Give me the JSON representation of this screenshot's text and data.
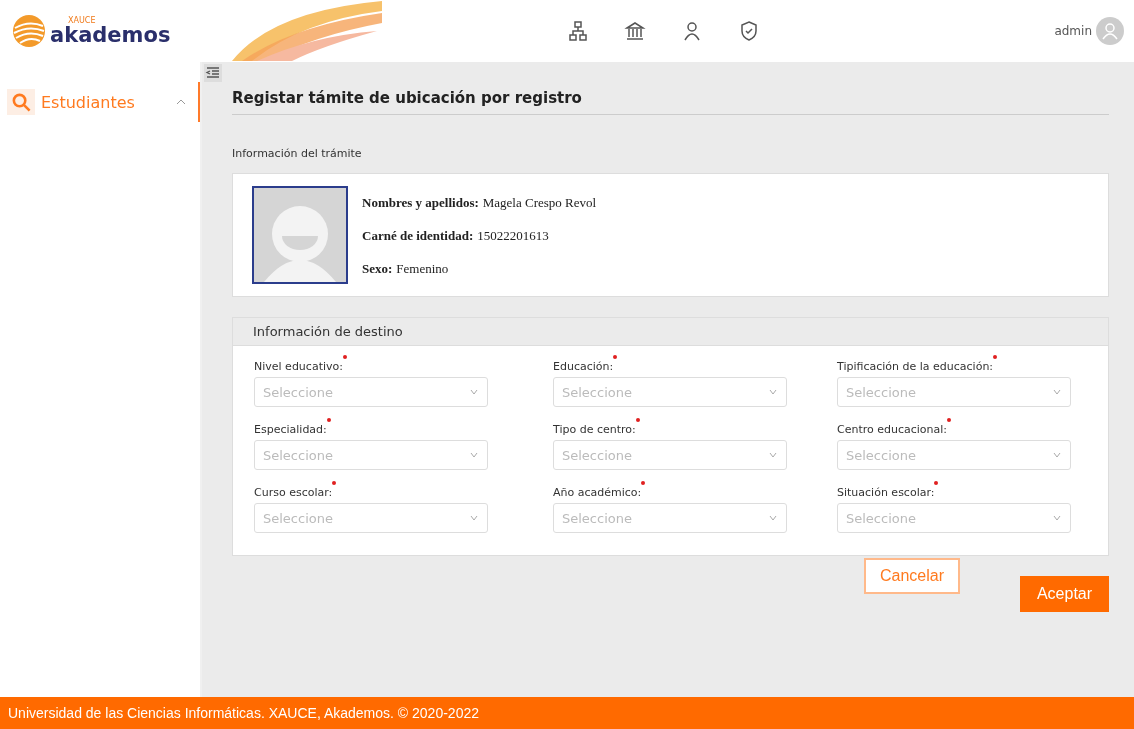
{
  "header": {
    "logo_small": "XAUCE",
    "logo": "akademos",
    "user": "admin"
  },
  "sidebar": {
    "items": [
      {
        "label": "Estudiantes",
        "expanded": true,
        "selected": true
      }
    ]
  },
  "page": {
    "title": "Registar támite de ubicación por registro",
    "section_label": "Información del trámite"
  },
  "student": {
    "fields": [
      {
        "label": "Nombres y apellidos:",
        "value": "Magela Crespo Revol"
      },
      {
        "label": "Carné de identidad:",
        "value": "15022201613"
      },
      {
        "label": "Sexo:",
        "value": "Femenino"
      }
    ]
  },
  "destination": {
    "title": "Información de destino",
    "fields": [
      {
        "label": "Nivel educativo:",
        "placeholder": "Seleccione",
        "required": true
      },
      {
        "label": "Educación:",
        "placeholder": "Seleccione",
        "required": true
      },
      {
        "label": "Tipificación de la educación:",
        "placeholder": "Seleccione",
        "required": true
      },
      {
        "label": "Especialidad:",
        "placeholder": "Seleccione",
        "required": true
      },
      {
        "label": "Tipo de centro:",
        "placeholder": "Seleccione",
        "required": true
      },
      {
        "label": "Centro educacional:",
        "placeholder": "Seleccione",
        "required": true
      },
      {
        "label": "Curso escolar:",
        "placeholder": "Seleccione",
        "required": true
      },
      {
        "label": "Año académico:",
        "placeholder": "Seleccione",
        "required": true
      },
      {
        "label": "Situación escolar:",
        "placeholder": "Seleccione",
        "required": true
      }
    ]
  },
  "buttons": [
    {
      "label": "Cancelar",
      "kind": "secondary"
    },
    {
      "label": "Aceptar",
      "kind": "primary"
    }
  ],
  "footer": "Universidad de las Ciencias Informáticas. XAUCE, Akademos. © 2020-2022"
}
